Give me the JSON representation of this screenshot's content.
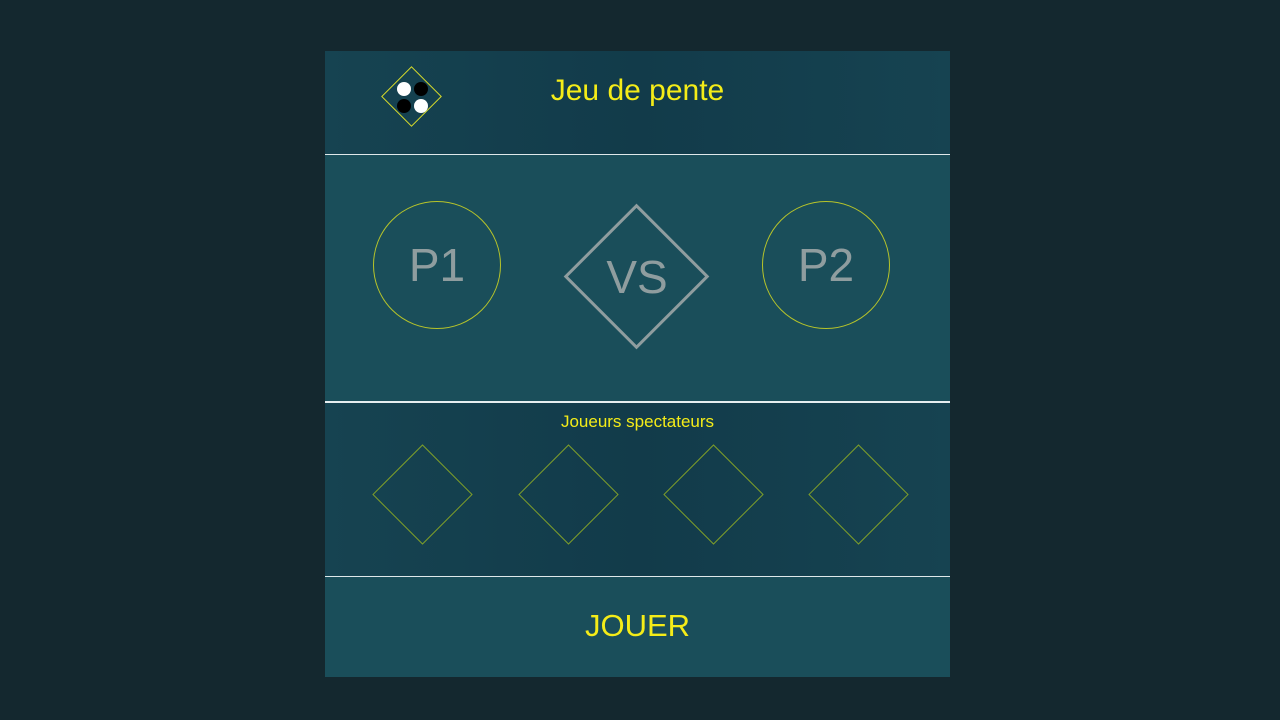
{
  "header": {
    "title": "Jeu de pente",
    "logo_icon": "pente-stones-icon",
    "logo_colors": {
      "border": "#d8dc2a",
      "white_stone": "#ffffff",
      "black_stone": "#000000"
    }
  },
  "versus": {
    "player1_label": "P1",
    "player2_label": "P2",
    "vs_label": "VS"
  },
  "spectators": {
    "title": "Joueurs spectateurs",
    "slot_count": 4
  },
  "play": {
    "button_label": "JOUER"
  },
  "colors": {
    "background": "#14282f",
    "panel": "#1a4e5a",
    "accent_yellow": "#f4ec18",
    "muted_text": "#8f9d9f",
    "outline_yellow": "#b7c42a",
    "outline_green": "#7e9e2a"
  }
}
